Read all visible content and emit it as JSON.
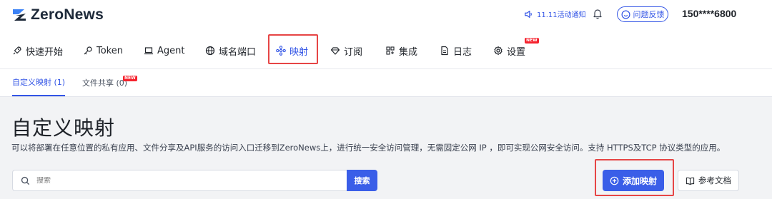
{
  "app": {
    "logo_text": "ZeroNews"
  },
  "header": {
    "notice_label": "11.11活动通知",
    "feedback_label": "问题反馈",
    "user_phone": "150****6800"
  },
  "nav": {
    "items": [
      {
        "label": "快速开始",
        "icon": "rocket-icon"
      },
      {
        "label": "Token",
        "icon": "key-icon"
      },
      {
        "label": "Agent",
        "icon": "laptop-icon"
      },
      {
        "label": "域名端口",
        "icon": "globe-icon"
      },
      {
        "label": "映射",
        "icon": "mapping-icon",
        "active": true
      },
      {
        "label": "订阅",
        "icon": "diamond-icon"
      },
      {
        "label": "集成",
        "icon": "grid-icon"
      },
      {
        "label": "日志",
        "icon": "file-icon"
      },
      {
        "label": "设置",
        "icon": "gear-icon",
        "badge": "NEW"
      }
    ]
  },
  "tabs": [
    {
      "label": "自定义映射 (1)",
      "active": true
    },
    {
      "label": "文件共享 (0)",
      "badge": "NEW"
    }
  ],
  "main": {
    "title": "自定义映射",
    "description": "可以将部署在任意位置的私有应用、文件分享及API服务的访问入口迁移到ZeroNews上，进行统一安全访问管理，无需固定公网 IP ，即可实现公网安全访问。支持 HTTPS及TCP 协议类型的应用。",
    "search_placeholder": "搜索",
    "search_button": "搜索",
    "add_button": "添加映射",
    "docs_button": "参考文档"
  },
  "colors": {
    "accent": "#3355e6",
    "highlight": "#e64545",
    "badge": "#f5222d"
  }
}
